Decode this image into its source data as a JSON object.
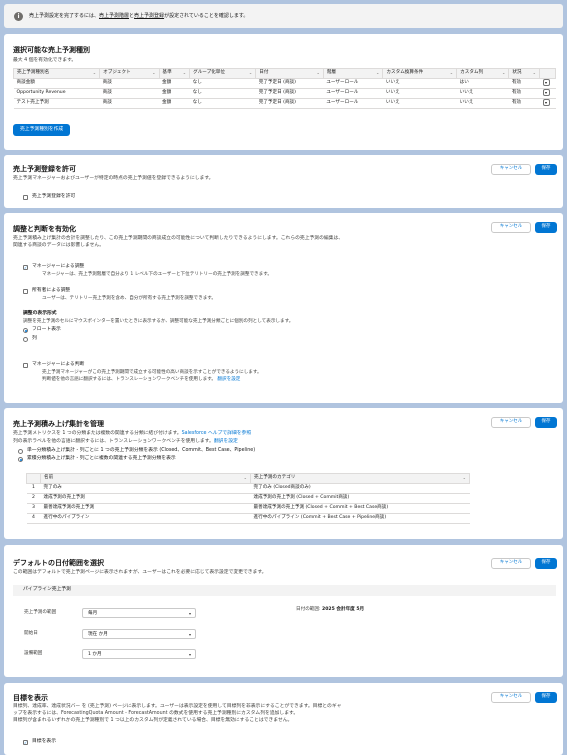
{
  "banner": {
    "text_before": "売上予測設定を完了するには、",
    "link1": "売上予測階層",
    "text_mid": "と",
    "link2": "売上予測登録",
    "text_after": "が設定されていることを確認します。"
  },
  "types": {
    "title": "選択可能な売上予測種別",
    "subtitle": "最大 4 個を有効化できます。",
    "columns": [
      "売上予測種別名",
      "オブジェクト",
      "基準",
      "グループ化単位",
      "日付",
      "階層",
      "カスタム換算条件",
      "カスタム列",
      "状況"
    ],
    "rows": [
      [
        "商談金額",
        "商談",
        "金額",
        "なし",
        "完了予定日 (商談)",
        "ユーザーロール",
        "いいえ",
        "はい",
        "有効"
      ],
      [
        "Opportunity Revenue",
        "商談",
        "金額",
        "なし",
        "完了予定日 (商談)",
        "ユーザーロール",
        "いいえ",
        "いいえ",
        "有効"
      ],
      [
        "テスト売上予測",
        "商談",
        "金額",
        "なし",
        "完了予定日 (商談)",
        "ユーザーロール",
        "いいえ",
        "いいえ",
        "有効"
      ]
    ],
    "create_button": "売上予測種別を作成"
  },
  "buttons": {
    "cancel": "キャンセル",
    "save": "保存"
  },
  "allow": {
    "title": "売上予測登録を許可",
    "desc": "売上予測マネージャーおよびユーザーが特定の時点の売上予測値を登録できるようにします。",
    "checkbox": "売上予測登録を許可"
  },
  "adjust": {
    "title": "調整と判断を有効化",
    "desc1": "売上予測積み上げ集計の合計を調整したり、この売上予測期間の商談成立の可能性について判断したりできるようにします。これらの売上予測の編集は、",
    "desc2": "関連する商談のデータには影響しません。",
    "mgr_label": "マネージャーによる調整",
    "mgr_desc": "マネージャーは、売上予測階層で自分より 1 レベル下のユーザーと下位テリトリーの売上予測を調整できます。",
    "owner_label": "所有者による調整",
    "owner_desc": "ユーザーは、テリトリー売上予測を含め、自分が所有する売上予測を調整できます。",
    "format_title": "調整の表示形式",
    "format_desc": "調整を売上予測のセルにマウスポインターを置いたときに表示するか、調整可能な売上予測分類ごとに個別の列として表示します。",
    "radio1": "フロート表示",
    "radio2": "列",
    "judge_label": "マネージャーによる判断",
    "judge_desc1": "売上予測マネージャーがこの売上予測期間で成立する可能性の高い商談を示すことができるようにします。",
    "judge_desc2": "判断値を他の言語に翻訳するには、トランスレーションワークベンチを使用します。",
    "judge_link": "翻訳を設定"
  },
  "rollup": {
    "title": "売上予測積み上げ集計を管理",
    "desc1_a": "売上予測メトリクスを 1 つの分類または複数の関連する分類に結び付けます。",
    "desc1_link": "Salesforce ヘルプで詳細を参照",
    "desc2_a": "列の表示ラベルを他の言語に翻訳するには、トランスレーションワークベンチを使用します。",
    "desc2_link": "翻訳を設定",
    "radio1": "単一分類積み上げ集計 - 列ごとに 1 つの売上予測分類を表示 (Closed、Commit、Best Case、Pipeline)",
    "radio2": "累積分類積み上げ集計 - 列ごとに複数の関連する売上予測分類を表示",
    "col_name": "名前",
    "col_cat": "売上予測のカテゴリ",
    "rows": [
      {
        "n": "1",
        "name": "完了のみ",
        "cat": "完了のみ (Closed商談のみ)"
      },
      {
        "n": "2",
        "name": "達成予測の売上予測",
        "cat": "達成予測の売上予測 (Closed + Commit商談)"
      },
      {
        "n": "3",
        "name": "最善達成予測の売上予測",
        "cat": "最善達成予測の売上予測 (Closed + Commit + Best Case商談)"
      },
      {
        "n": "4",
        "name": "進行中のパイプライン",
        "cat": "進行中のパイプライン (Commit + Best Case + Pipeline商談)"
      }
    ]
  },
  "daterange": {
    "title": "デフォルトの日付範囲を選択",
    "desc": "この範囲はデフォルトで売上予測ページに表示されますが、ユーザーはこれを必要に応じて表示設定で変更できます。",
    "subsection": "パイプライン売上予測",
    "period_label": "売上予測の範囲",
    "period_value": "毎月",
    "start_label": "開始日",
    "start_value": "現在 か月",
    "display_label": "設備範囲",
    "display_value": "1 か月",
    "range_label": "日付の範囲:",
    "range_value": "2025 会計年度 5月"
  },
  "goals": {
    "title": "目標を表示",
    "desc1": "目標列、達成率、達成状況バー を (売上予測) ページに表示します。ユーザーは表示設定を使用して目標列を非表示にすることができます。目標とのギャ",
    "desc2": "ップを表示するには、ForecastingQuota Amount - ForecastAmount の数式を使用する売上予測種別にカスタム列を追加します。",
    "desc3": "目標列が含まれるいずれかの売上予測種別で 1 つ以上のカスタム列が定義されている場合、目標を無効にすることはできません。",
    "checkbox": "目標を表示"
  }
}
